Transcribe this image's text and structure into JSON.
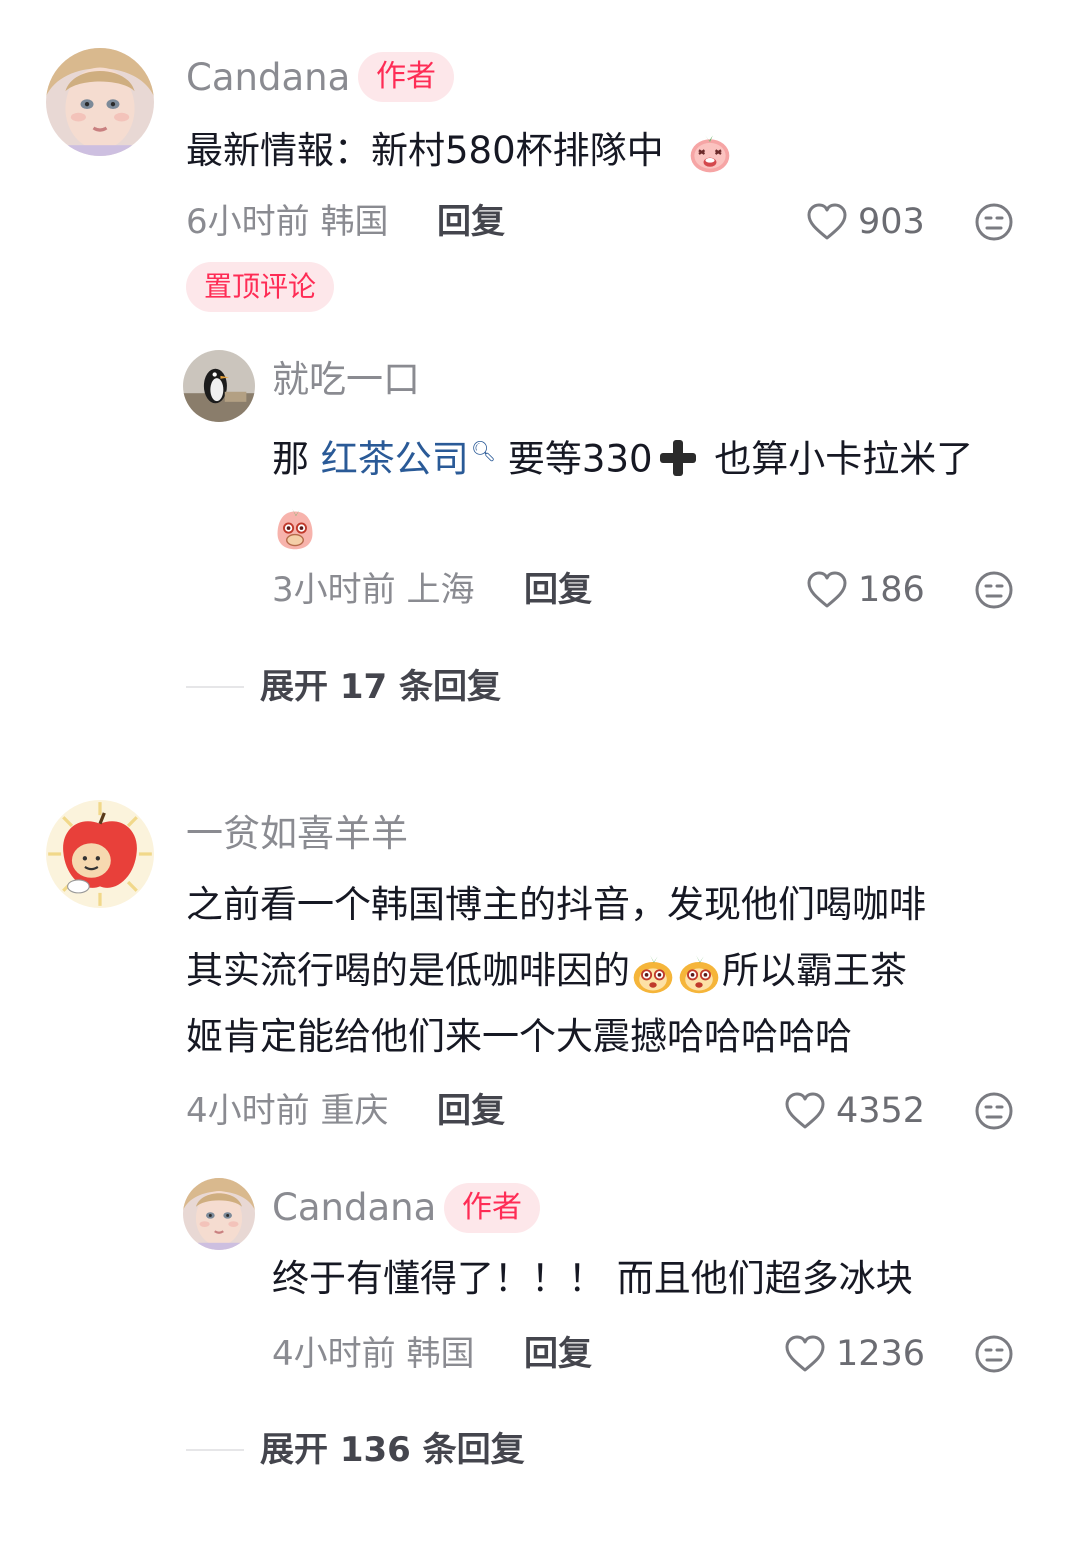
{
  "comments": [
    {
      "username": "Candana",
      "author_tag": "作者",
      "text": "最新情報：新村580杯排隊中",
      "time_location": "6小时前 韩国",
      "reply_label": "回复",
      "likes": "903",
      "pin_tag": "置顶评论",
      "replies": [
        {
          "username": "就吃一口",
          "text_prefix": "那 ",
          "link_text": "红茶公司",
          "text_mid": " 要等330",
          "text_suffix": " 也算小卡拉米了",
          "time_location": "3小时前 上海",
          "reply_label": "回复",
          "likes": "186"
        }
      ],
      "expand_label": "展开 17 条回复"
    },
    {
      "username": "一贫如喜羊羊",
      "text_line1": "之前看一个韩国博主的抖音，发现他们喝咖啡",
      "text_line2a": "其实流行喝的是低咖啡因的",
      "text_line2b": "所以霸王茶",
      "text_line3": "姬肯定能给他们来一个大震撼哈哈哈哈哈",
      "time_location": "4小时前 重庆",
      "reply_label": "回复",
      "likes": "4352",
      "replies": [
        {
          "username": "Candana",
          "author_tag": "作者",
          "text": "终于有懂得了！！！ 而且他们超多冰块",
          "time_location": "4小时前 韩国",
          "reply_label": "回复",
          "likes": "1236"
        }
      ],
      "expand_label": "展开 136 条回复"
    }
  ],
  "colors": {
    "accent": "#fe2c55",
    "tag_bg": "#fde7ea",
    "link": "#2a5a97",
    "muted": "#8a8b91"
  },
  "icons": [
    "heart-outline-icon",
    "dislike-face-icon",
    "search-hint-icon",
    "heavy-plus-icon"
  ]
}
